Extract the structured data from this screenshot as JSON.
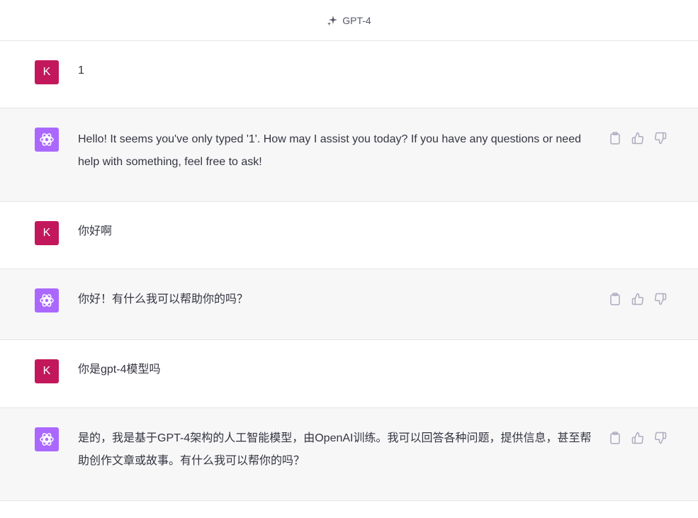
{
  "header": {
    "model_label": "GPT-4",
    "icon": "sparkle-icon"
  },
  "conversation": [
    {
      "role": "user",
      "avatar_letter": "K",
      "text": "1"
    },
    {
      "role": "assistant",
      "avatar_icon": "openai-logo-icon",
      "text": "Hello! It seems you've only typed '1'. How may I assist you today? If you have any questions or need help with something, feel free to ask!"
    },
    {
      "role": "user",
      "avatar_letter": "K",
      "text": "你好啊"
    },
    {
      "role": "assistant",
      "avatar_icon": "openai-logo-icon",
      "text": "你好！有什么我可以帮助你的吗？"
    },
    {
      "role": "user",
      "avatar_letter": "K",
      "text": "你是gpt-4模型吗"
    },
    {
      "role": "assistant",
      "avatar_icon": "openai-logo-icon",
      "text": "是的，我是基于GPT-4架构的人工智能模型，由OpenAI训练。我可以回答各种问题，提供信息，甚至帮助创作文章或故事。有什么我可以帮你的吗？"
    }
  ],
  "message_actions": [
    "copy-icon",
    "thumbs-up-icon",
    "thumbs-down-icon"
  ],
  "colors": {
    "user_avatar": "#c2185b",
    "assistant_avatar": "#ab68ff",
    "assistant_bg": "#f7f7f8",
    "text": "#343541",
    "icon": "#acacbe"
  }
}
